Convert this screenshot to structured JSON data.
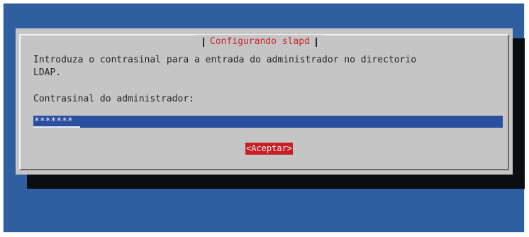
{
  "dialog": {
    "title": "Configurando slapd",
    "description_line1": "Introduza o contrasinal para a entrada do administrador no directorio",
    "description_line2": "LDAP.",
    "field_label": "Contrasinal do administrador:",
    "password_value": "*******",
    "ok_label": "<Aceptar>"
  },
  "colors": {
    "screen_background": "#2f5fa1",
    "dialog_background": "#c5c5c5",
    "title_text": "#c8242a",
    "input_background": "#2b4fa0",
    "button_background": "#c61f25"
  }
}
